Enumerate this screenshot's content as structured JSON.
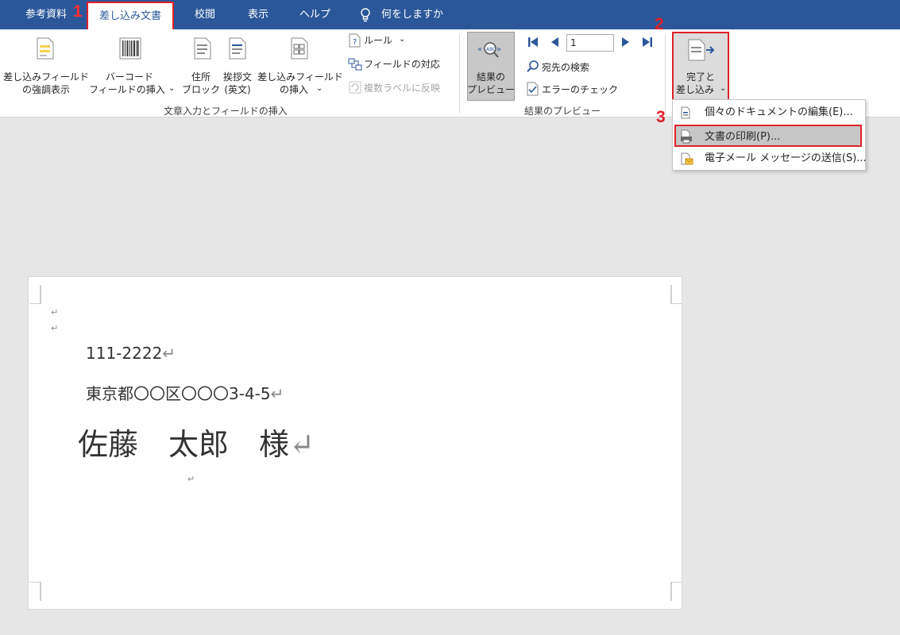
{
  "tabs": {
    "references": "参考資料",
    "mailings": "差し込み文書",
    "review": "校閲",
    "view": "表示",
    "help": "ヘルプ",
    "tell_me": "何をしますか"
  },
  "steps": {
    "one": "1",
    "two": "2",
    "three": "3"
  },
  "ribbon": {
    "highlight_fields": [
      "差し込みフィールド",
      "の強調表示"
    ],
    "barcode_field": [
      "バーコード",
      "フィールドの挿入"
    ],
    "address_block": [
      "住所",
      "ブロック"
    ],
    "greeting_line": [
      "挨拶文",
      "(英文)"
    ],
    "insert_merge_field": [
      "差し込みフィールド",
      "の挿入"
    ],
    "rules": "ルール",
    "match_fields": "フィールドの対応",
    "update_labels": "複数ラベルに反映",
    "group_write_insert": "文章入力とフィールドの挿入",
    "preview_results": [
      "結果の",
      "プレビュー"
    ],
    "record_number": "1",
    "find_recipient": "宛先の検索",
    "check_errors": "エラーのチェック",
    "group_preview": "結果のプレビュー",
    "finish_merge": [
      "完了と",
      "差し込み"
    ]
  },
  "dropdown": {
    "edit_documents": "個々のドキュメントの編集(E)...",
    "print_documents": "文書の印刷(P)...",
    "send_email": "電子メール メッセージの送信(S)..."
  },
  "document": {
    "postal_code": "111-2222",
    "address": "東京都〇〇区〇〇〇3-4-5",
    "recipient": "佐藤　太郎　様",
    "para_mark": "↵"
  },
  "colors": {
    "accent": "#2b579a",
    "highlight_border": "#e0202a"
  }
}
